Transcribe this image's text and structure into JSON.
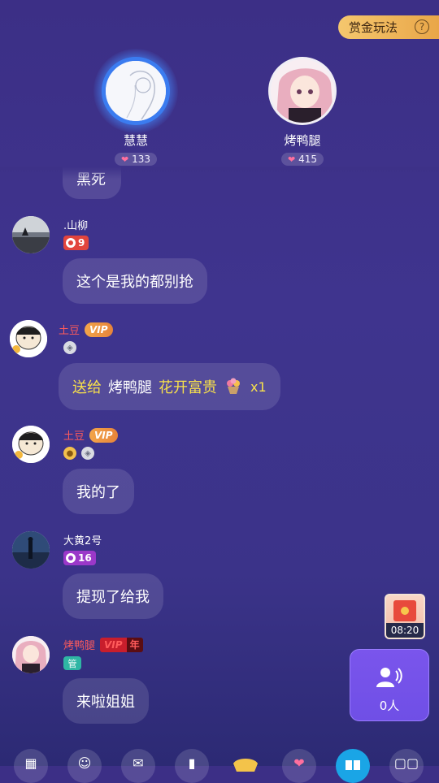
{
  "header": {
    "bounty_label": "赏金玩法",
    "help_icon": "?"
  },
  "seats": [
    {
      "name": "慧慧",
      "likes": "133"
    },
    {
      "name": "烤鸭腿",
      "likes": "415"
    }
  ],
  "partial_message": "黑死",
  "messages": [
    {
      "user": ".山柳",
      "level": "9",
      "text": "这个是我的都别抢"
    },
    {
      "user": "土豆",
      "vip": "VIP",
      "gift": {
        "send": "送给",
        "to": "烤鸭腿",
        "name": "花开富贵",
        "count": "x1"
      }
    },
    {
      "user": "土豆",
      "vip": "VIP",
      "text": "我的了"
    },
    {
      "user": "大黄2号",
      "level": "16",
      "text": "提现了给我"
    },
    {
      "user": "烤鸭腿",
      "vip": "VIP",
      "vip_year": "年",
      "role": "管",
      "text": "来啦姐姐"
    }
  ],
  "redpacket": {
    "timer": "08:20"
  },
  "audience": {
    "count": "0人"
  },
  "colors": {
    "accent": "#3b7cf0",
    "gift_highlight": "#f8e14b",
    "username_red": "#ff5b5b"
  }
}
